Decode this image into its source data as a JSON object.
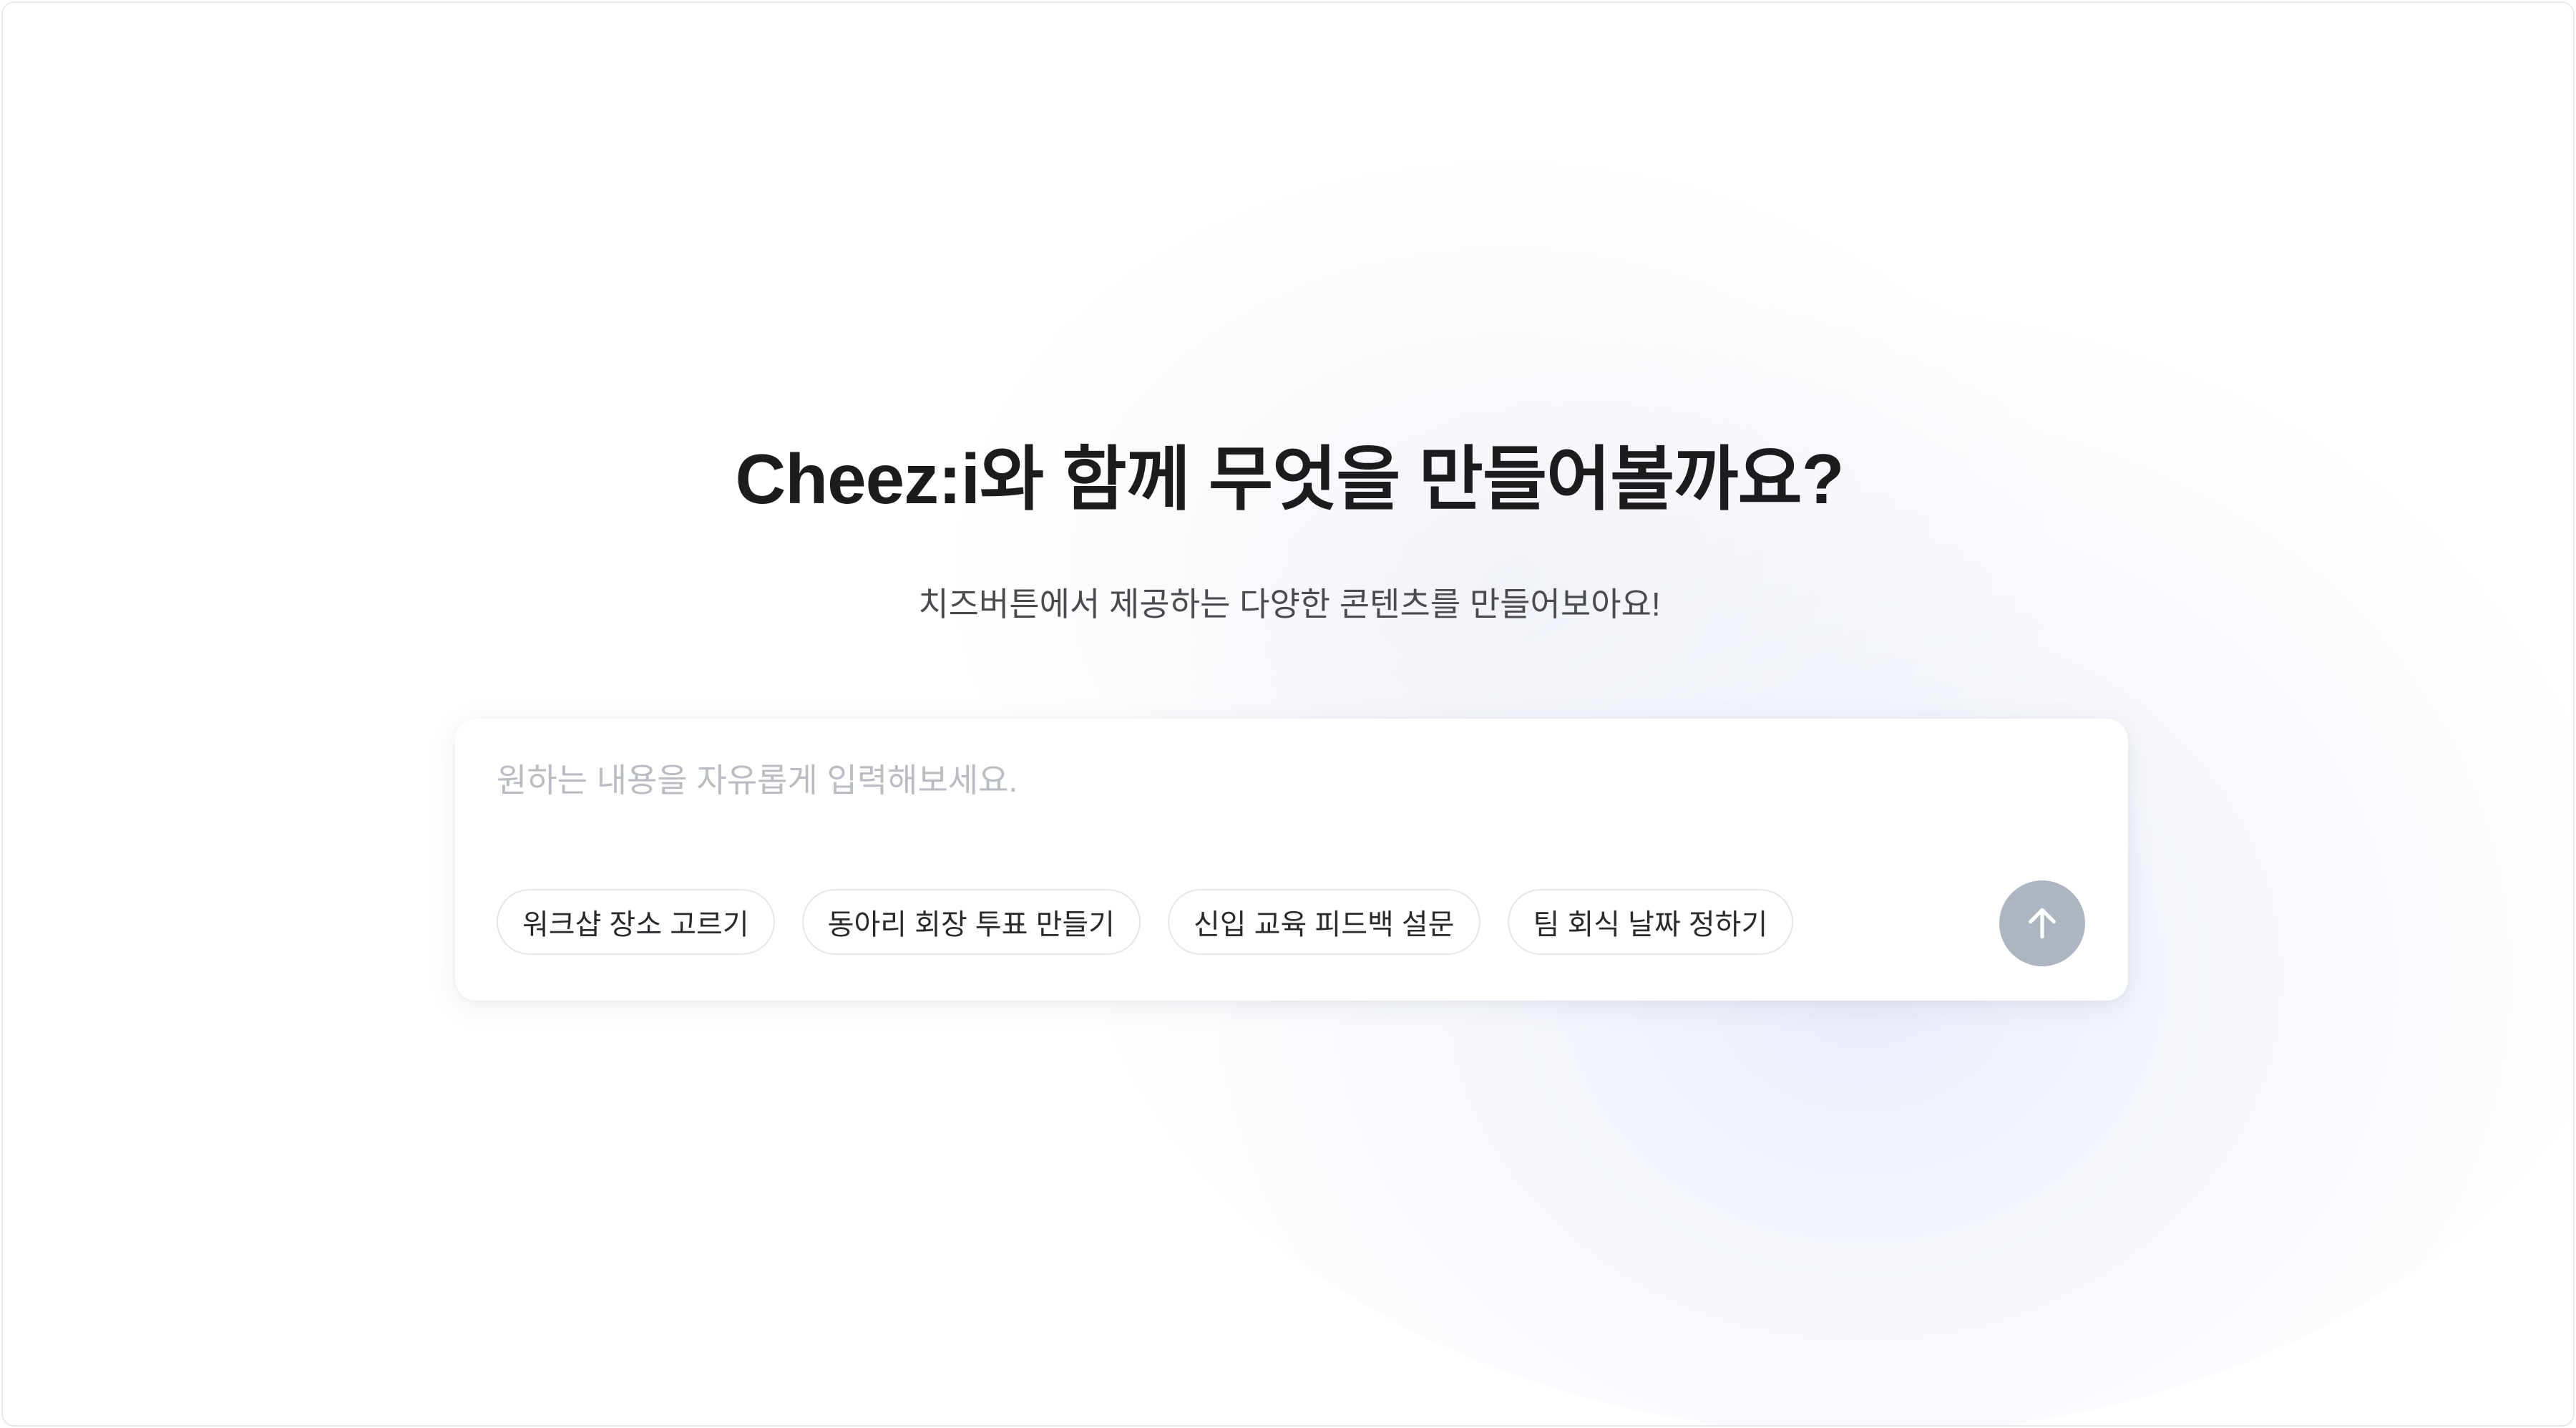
{
  "hero": {
    "title": "Cheez:i와 함께 무엇을 만들어볼까요?",
    "subtitle": "치즈버튼에서 제공하는 다양한 콘텐츠를 만들어보아요!"
  },
  "prompt": {
    "placeholder": "원하는 내용을 자유롭게 입력해보세요.",
    "value": ""
  },
  "suggestions": [
    {
      "label": "워크샵 장소 고르기"
    },
    {
      "label": "동아리 회장 투표 만들기"
    },
    {
      "label": "신입 교육 피드백 설문"
    },
    {
      "label": "팀 회식 날짜 정하기"
    }
  ],
  "send_button": {
    "icon": "arrow-up-icon",
    "color": "#adb5c2"
  },
  "colors": {
    "title": "#1c1c1e",
    "subtitle": "#4a4a4f",
    "background": "#ffffff"
  }
}
